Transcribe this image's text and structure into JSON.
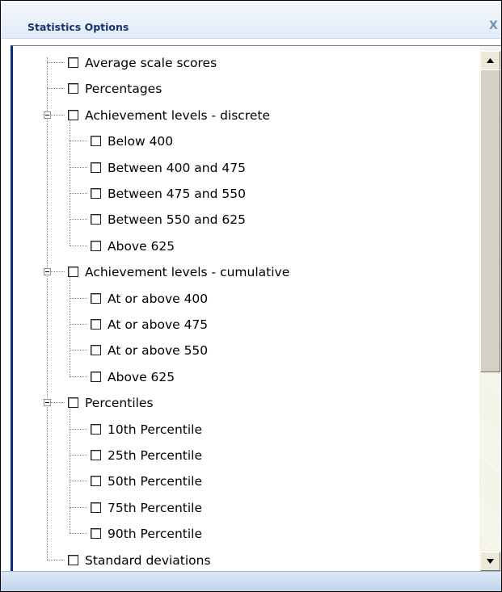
{
  "window": {
    "title": "Statistics Options",
    "close_label": "X"
  },
  "tree": {
    "items": [
      {
        "label": "Average scale scores",
        "checked": false,
        "level": 0
      },
      {
        "label": "Percentages",
        "checked": false,
        "level": 0
      },
      {
        "label": "Achievement levels - discrete",
        "checked": false,
        "level": 0,
        "expanded": true
      },
      {
        "label": "Below 400",
        "checked": false,
        "level": 1
      },
      {
        "label": "Between 400 and 475",
        "checked": false,
        "level": 1
      },
      {
        "label": "Between 475 and 550",
        "checked": false,
        "level": 1
      },
      {
        "label": "Between 550 and 625",
        "checked": false,
        "level": 1
      },
      {
        "label": "Above 625",
        "checked": false,
        "level": 1
      },
      {
        "label": "Achievement levels - cumulative",
        "checked": false,
        "level": 0,
        "expanded": true
      },
      {
        "label": "At or above 400",
        "checked": false,
        "level": 1
      },
      {
        "label": "At or above 475",
        "checked": false,
        "level": 1
      },
      {
        "label": "At or above 550",
        "checked": false,
        "level": 1
      },
      {
        "label": "Above 625",
        "checked": false,
        "level": 1
      },
      {
        "label": "Percentiles",
        "checked": false,
        "level": 0,
        "expanded": true
      },
      {
        "label": "10th Percentile",
        "checked": false,
        "level": 1
      },
      {
        "label": "25th Percentile",
        "checked": false,
        "level": 1
      },
      {
        "label": "50th Percentile",
        "checked": false,
        "level": 1
      },
      {
        "label": "75th Percentile",
        "checked": false,
        "level": 1
      },
      {
        "label": "90th Percentile",
        "checked": false,
        "level": 1
      },
      {
        "label": "Standard deviations",
        "checked": false,
        "level": 0
      }
    ]
  },
  "icons": {
    "close": "close-icon",
    "expander": "minus-icon",
    "scroll_up": "arrow-up-icon",
    "scroll_down": "arrow-down-icon"
  },
  "colors": {
    "title_text": "#13366c",
    "panel_border": "#0a2a78",
    "close_icon": "#7590b6"
  }
}
